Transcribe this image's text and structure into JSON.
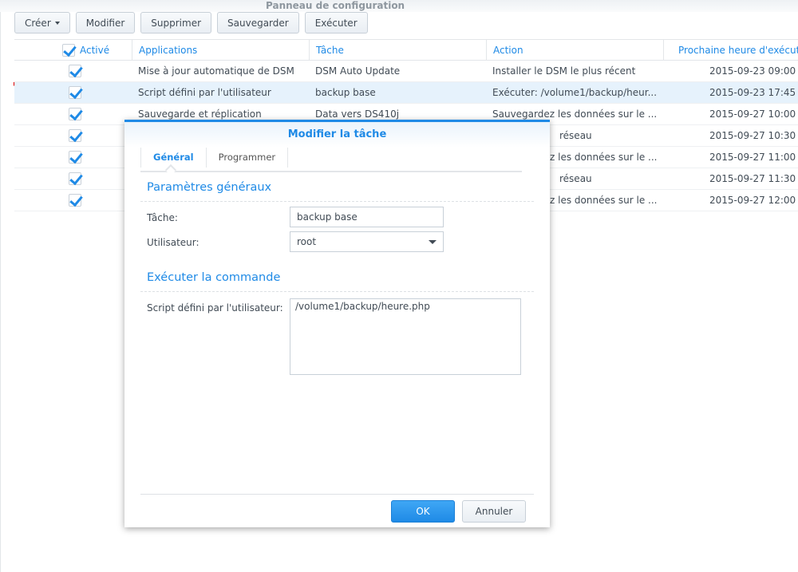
{
  "window": {
    "title": "Panneau de configuration"
  },
  "toolbar": {
    "create": "Créer",
    "modify": "Modifier",
    "delete": "Supprimer",
    "save": "Sauvegarder",
    "run": "Exécuter"
  },
  "table": {
    "headers": [
      "Activé",
      "Applications",
      "Tâche",
      "Action",
      "Prochaine heure d'exécut"
    ],
    "rows": [
      {
        "enabled": true,
        "app": "Mise à jour automatique de DSM",
        "task": "DSM Auto Update",
        "action": "Installer le DSM le plus récent",
        "next": "2015-09-23 09:00"
      },
      {
        "enabled": true,
        "app": "Script défini par l'utilisateur",
        "task": "backup base",
        "action": "Exécuter: /volume1/backup/heur...",
        "next": "2015-09-23 17:45",
        "selected": true
      },
      {
        "enabled": true,
        "app": "Sauvegarde et réplication",
        "task": "Data vers DS410j",
        "action": "Sauvegardez les données sur le ...",
        "next": "2015-09-27 10:00"
      },
      {
        "enabled": true,
        "app": "",
        "task": "",
        "action": "réseau",
        "next": "2015-09-27 10:30"
      },
      {
        "enabled": true,
        "app": "",
        "task": "",
        "action": "z les données sur le ...",
        "next": "2015-09-27 11:00"
      },
      {
        "enabled": true,
        "app": "",
        "task": "",
        "action": "réseau",
        "next": "2015-09-27 11:30"
      },
      {
        "enabled": true,
        "app": "",
        "task": "",
        "action": "z les données sur le ...",
        "next": "2015-09-27 12:00"
      }
    ]
  },
  "dialog": {
    "title": "Modifier la tâche",
    "tabs": [
      "Général",
      "Programmer"
    ],
    "section_general": "Paramètres généraux",
    "task_label": "Tâche:",
    "task_value": "backup base",
    "user_label": "Utilisateur:",
    "user_value": "root",
    "section_command": "Exécuter la commande",
    "script_label": "Script défini par l'utilisateur:",
    "script_value": "/volume1/backup/heure.php",
    "ok": "OK",
    "cancel": "Annuler"
  },
  "colors": {
    "accent": "#1f8ae6",
    "selected_row": "#e6f2fc"
  }
}
